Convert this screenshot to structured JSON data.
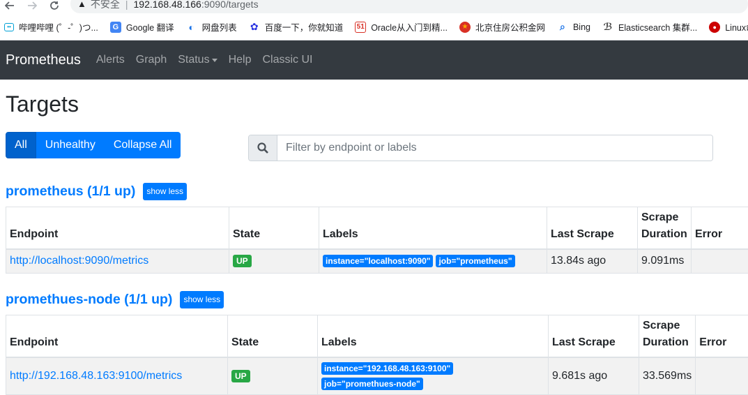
{
  "browser": {
    "security_warning": "不安全",
    "url_host": "192.168.48.166",
    "url_path": ":9090/targets",
    "bookmarks": [
      {
        "label": "哔哩哔哩 (゜-゜)つ...",
        "icon": "bilibili-icon"
      },
      {
        "label": "Google 翻译",
        "icon": "google-translate-icon"
      },
      {
        "label": "网盘列表",
        "icon": "cloud-drive-icon"
      },
      {
        "label": "百度一下，你就知道",
        "icon": "baidu-icon"
      },
      {
        "label": "Oracle从入门到精...",
        "icon": "site-51-icon"
      },
      {
        "label": "北京住房公积金网",
        "icon": "housing-fund-icon"
      },
      {
        "label": "Bing",
        "icon": "bing-icon"
      },
      {
        "label": "Elasticsearch 集群...",
        "icon": "elasticsearch-icon"
      },
      {
        "label": "Linux命令",
        "icon": "redhat-icon"
      }
    ]
  },
  "navbar": {
    "brand": "Prometheus",
    "links": [
      "Alerts",
      "Graph",
      "Status",
      "Help",
      "Classic UI"
    ]
  },
  "page": {
    "title": "Targets",
    "buttons": {
      "all": "All",
      "unhealthy": "Unhealthy",
      "collapse": "Collapse All"
    },
    "filter_placeholder": "Filter by endpoint or labels"
  },
  "table_headers": {
    "endpoint": "Endpoint",
    "state": "State",
    "labels": "Labels",
    "last_scrape": "Last Scrape",
    "scrape_duration_1": "Scrape",
    "scrape_duration_2": "Duration",
    "error": "Error"
  },
  "pools": [
    {
      "title": "prometheus (1/1 up)",
      "toggle": "show less",
      "endpoint": "http://localhost:9090/metrics",
      "state": "UP",
      "labels": [
        "instance=\"localhost:9090\"",
        "job=\"prometheus\""
      ],
      "last_scrape": "13.84s ago",
      "duration": "9.091ms",
      "error": ""
    },
    {
      "title": "promethues-node (1/1 up)",
      "toggle": "show less",
      "endpoint": "http://192.168.48.163:9100/metrics",
      "state": "UP",
      "labels": [
        "instance=\"192.168.48.163:9100\"",
        "job=\"promethues-node\""
      ],
      "last_scrape": "9.681s ago",
      "duration": "33.569ms",
      "error": ""
    }
  ],
  "colors": {
    "brand_blue": "#007bff",
    "up_green": "#28a745",
    "navbar_dark": "#343a40"
  }
}
